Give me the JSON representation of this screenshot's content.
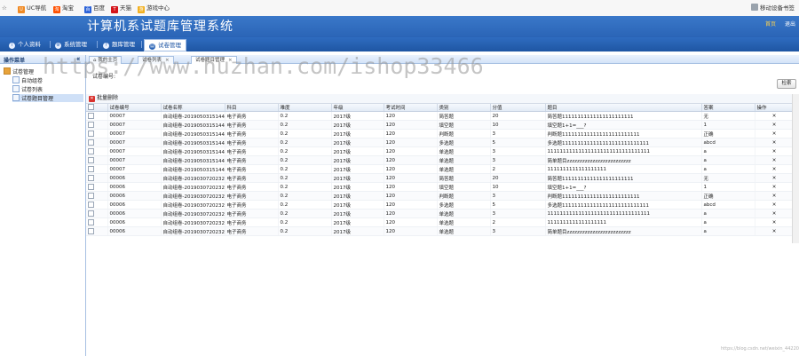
{
  "browser": {
    "bookmarks": [
      "UC导航",
      "淘宝",
      "百度",
      "天猫",
      "游戏中心"
    ],
    "right_text": "移动设备书签"
  },
  "header": {
    "title": "计算机系试题库管理系统",
    "top_links": [
      "首页",
      "退出"
    ]
  },
  "nav": {
    "items": [
      "个人资料",
      "系统管理",
      "题库管理",
      "试卷管理"
    ],
    "active_index": 3
  },
  "sidebar": {
    "title": "操作菜单",
    "root": "试卷管理",
    "items": [
      "自动组卷",
      "试卷列表",
      "试卷题目管理"
    ],
    "selected_index": 2
  },
  "tabs": {
    "items": [
      "我的主页",
      "试卷列表",
      "试卷题目管理"
    ],
    "active_index": 2
  },
  "search": {
    "label": "试卷编号:",
    "button": "检索"
  },
  "grid": {
    "batch_delete": "批量删除",
    "columns": [
      "试卷编号",
      "试卷名称",
      "科目",
      "难度",
      "年级",
      "考试时间",
      "类别",
      "分值",
      "题目",
      "答案",
      "操作"
    ],
    "rows": [
      [
        "00007",
        "自动组卷-20190503151444",
        "电子商务",
        "0.2",
        "2017级",
        "120",
        "简答题",
        "20",
        "简答题11111111111111111111111",
        "无"
      ],
      [
        "00007",
        "自动组卷-20190503151444",
        "电子商务",
        "0.2",
        "2017级",
        "120",
        "填空题",
        "10",
        "填空题1+1=___?",
        "1"
      ],
      [
        "00007",
        "自动组卷-20190503151444",
        "电子商务",
        "0.2",
        "2017级",
        "120",
        "判断题",
        "3",
        "判断题1111111111111111111111111",
        "正确"
      ],
      [
        "00007",
        "自动组卷-20190503151444",
        "电子商务",
        "0.2",
        "2017级",
        "120",
        "多选题",
        "5",
        "多选题1111111111111111111111111111",
        "abcd"
      ],
      [
        "00007",
        "自动组卷-20190503151444",
        "电子商务",
        "0.2",
        "2017级",
        "120",
        "单选题",
        "3",
        "111111111111111111111111111111111",
        "a"
      ],
      [
        "00007",
        "自动组卷-20190503151444",
        "电子商务",
        "0.2",
        "2017级",
        "120",
        "单选题",
        "3",
        "简单题目zzzzzzzzzzzzzzzzzzzzzzzzz",
        "a"
      ],
      [
        "00007",
        "自动组卷-20190503151444",
        "电子商务",
        "0.2",
        "2017级",
        "120",
        "单选题",
        "2",
        "1111111111111111111",
        "a"
      ],
      [
        "00006",
        "自动组卷-20190307202320",
        "电子商务",
        "0.2",
        "2017级",
        "120",
        "简答题",
        "20",
        "简答题11111111111111111111111",
        "无"
      ],
      [
        "00006",
        "自动组卷-20190307202320",
        "电子商务",
        "0.2",
        "2017级",
        "120",
        "填空题",
        "10",
        "填空题1+1=___?",
        "1"
      ],
      [
        "00006",
        "自动组卷-20190307202320",
        "电子商务",
        "0.2",
        "2017级",
        "120",
        "判断题",
        "3",
        "判断题1111111111111111111111111",
        "正确"
      ],
      [
        "00006",
        "自动组卷-20190307202320",
        "电子商务",
        "0.2",
        "2017级",
        "120",
        "多选题",
        "5",
        "多选题1111111111111111111111111111",
        "abcd"
      ],
      [
        "00006",
        "自动组卷-20190307202320",
        "电子商务",
        "0.2",
        "2017级",
        "120",
        "单选题",
        "3",
        "111111111111111111111111111111111",
        "a"
      ],
      [
        "00006",
        "自动组卷-20190307202320",
        "电子商务",
        "0.2",
        "2017级",
        "120",
        "单选题",
        "2",
        "1111111111111111111",
        "a"
      ],
      [
        "00006",
        "自动组卷-20190307202320",
        "电子商务",
        "0.2",
        "2017级",
        "120",
        "单选题",
        "3",
        "简单题目zzzzzzzzzzzzzzzzzzzzzzzzz",
        "a"
      ]
    ]
  },
  "watermark": "https://www.huzhan.com/ishop33466",
  "footer_watermark": "https://blog.csdn.net/weixin_44220"
}
